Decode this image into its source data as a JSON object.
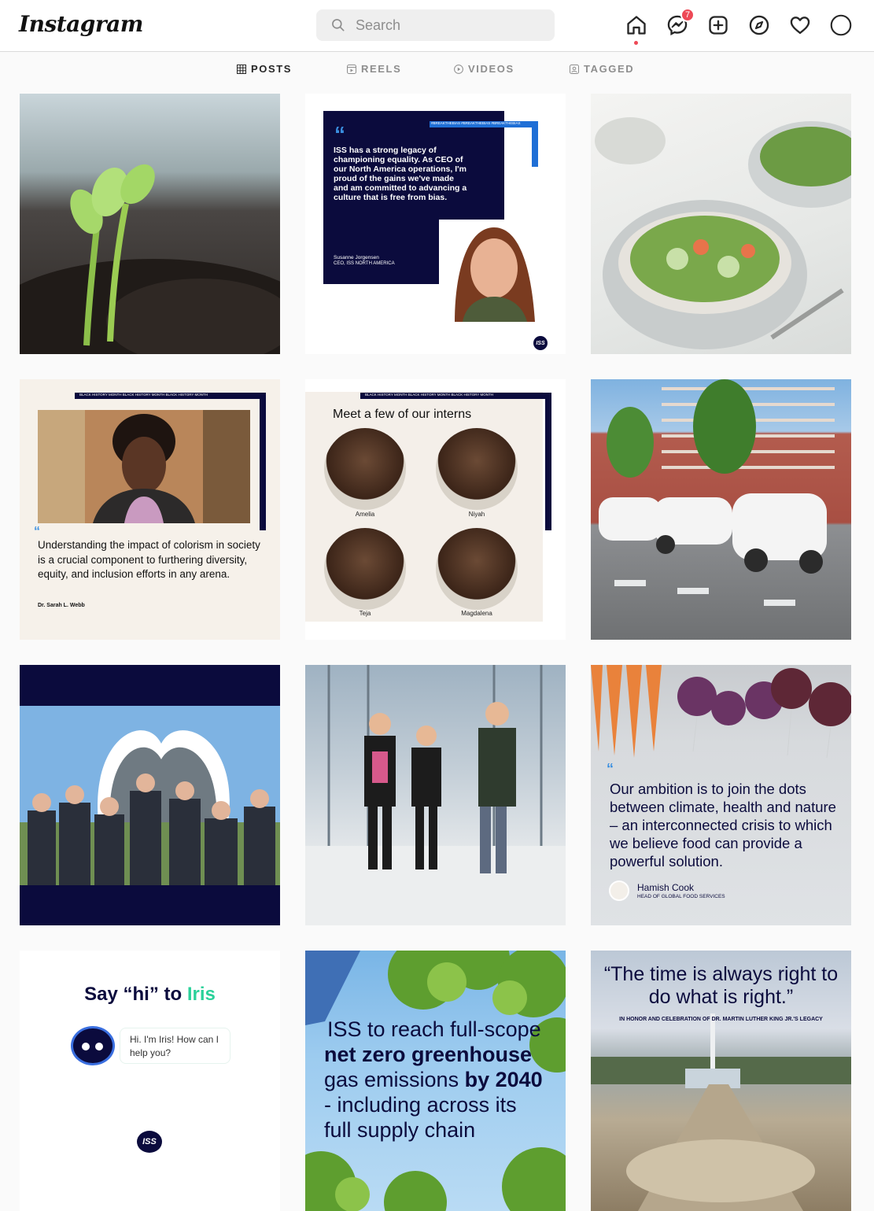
{
  "header": {
    "logo_text": "Instagram",
    "search_placeholder": "Search",
    "messenger_badge": "7"
  },
  "icons": {
    "home": "home-icon",
    "messenger": "messenger-icon",
    "create": "plus-square-icon",
    "explore": "compass-icon",
    "activity": "heart-icon",
    "profile": "profile-avatar-icon"
  },
  "tabs": [
    {
      "label": "POSTS",
      "active": true
    },
    {
      "label": "REELS",
      "active": false
    },
    {
      "label": "VIDEOS",
      "active": false
    },
    {
      "label": "TAGGED",
      "active": false
    }
  ],
  "posts": {
    "p2": {
      "tag_strip": "#BREAKTHEBIAS  #BREAKTHEBIAS  #BREAKTHEBIAS",
      "quote_mark": "“",
      "quote": "ISS has a strong legacy of championing equality. As CEO of our North America operations, I'm proud of the gains we've made and am committed to advancing a culture that is free from bias.",
      "author": "Susanne Jorgensen",
      "author_title": "CEO, ISS NORTH AMERICA",
      "logo": "ISS"
    },
    "p4": {
      "strip": "BLACK HISTORY MONTH  BLACK HISTORY MONTH  BLACK HISTORY MONTH",
      "quote_mark": "“",
      "quote": "Understanding the impact of colorism in society is a crucial component to furthering diversity, equity, and inclusion efforts in any arena.",
      "author": "Dr. Sarah L. Webb"
    },
    "p5": {
      "strip": "BLACK HISTORY MONTH  BLACK HISTORY MONTH  BLACK HISTORY MONTH",
      "title": "Meet a few of our interns",
      "names": [
        "Amelia",
        "Niyah",
        "Teja",
        "Magdalena"
      ]
    },
    "p9": {
      "quote_mark": "“",
      "quote": "Our ambition is to join the dots between climate, health and nature – an interconnected crisis to which we believe food can provide a powerful solution.",
      "author": "Hamish Cook",
      "author_title": "HEAD OF GLOBAL FOOD SERVICES"
    },
    "p10": {
      "title_prefix": "Say “hi” to ",
      "title_name": "Iris",
      "bubble": "Hi. I'm Iris! How can I help you?",
      "logo": "ISS"
    },
    "p11": {
      "line1": "ISS to reach full-scope",
      "line2": "net zero greenhouse",
      "line3a": "gas emissions ",
      "line3b": "by 2040",
      "line4": "- including across its",
      "line5": "full supply chain"
    },
    "p12": {
      "quote": "“The time is always right to do what is right.”",
      "sub": "IN HONOR AND CELEBRATION OF DR. MARTIN LUTHER KING JR.'S LEGACY"
    }
  }
}
